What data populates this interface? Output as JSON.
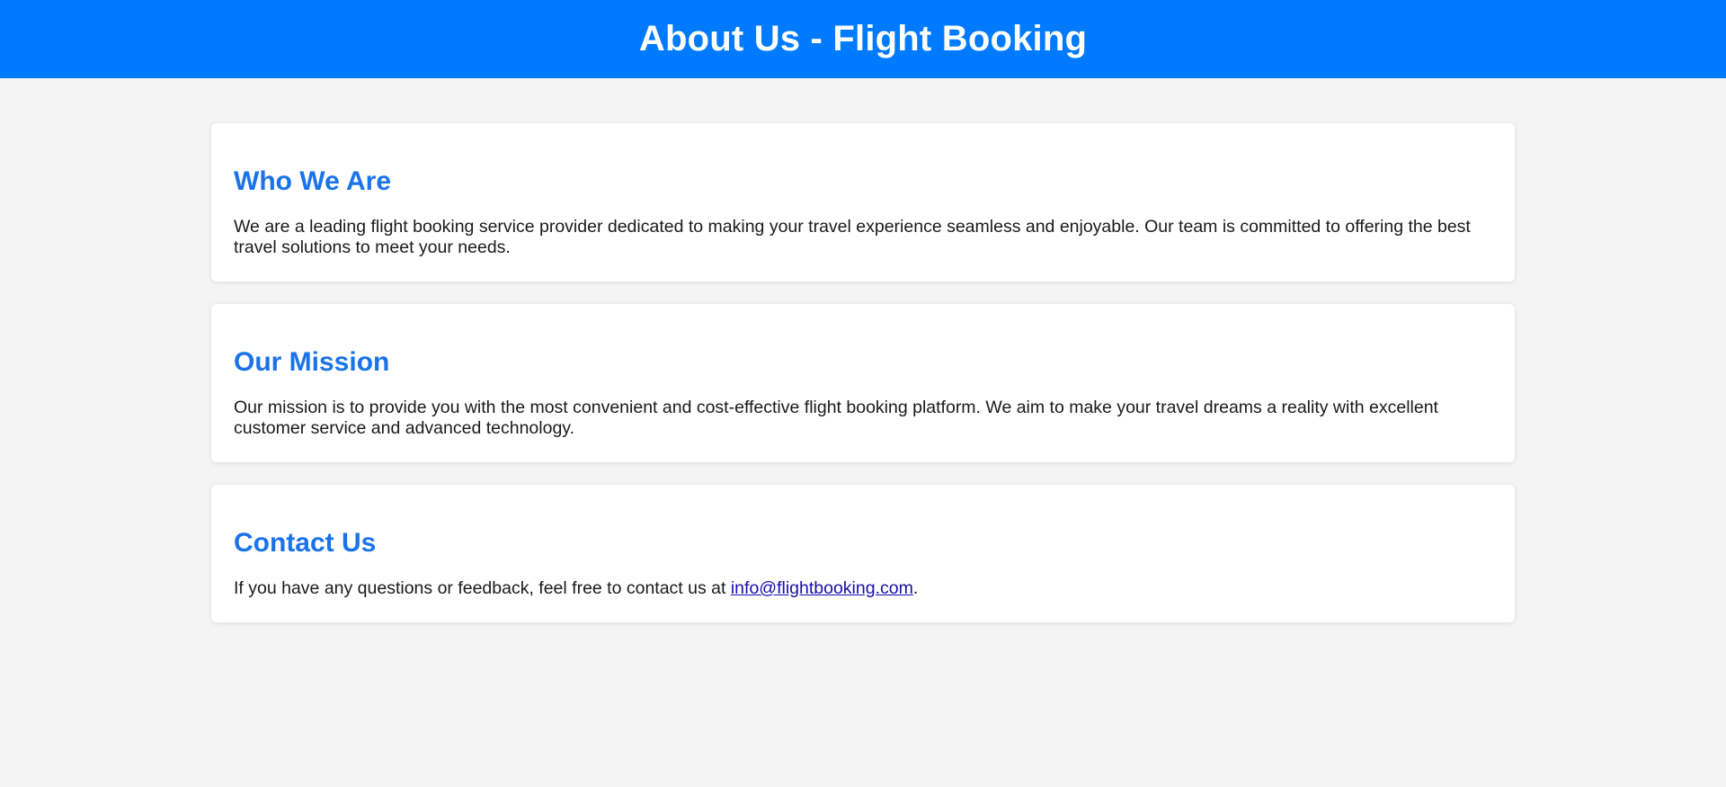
{
  "header": {
    "title": "About Us - Flight Booking"
  },
  "sections": [
    {
      "heading": "Who We Are",
      "text": "We are a leading flight booking service provider dedicated to making your travel experience seamless and enjoyable. Our team is committed to offering the best travel solutions to meet your needs."
    },
    {
      "heading": "Our Mission",
      "text": "Our mission is to provide you with the most convenient and cost-effective flight booking platform. We aim to make your travel dreams a reality with excellent customer service and advanced technology."
    },
    {
      "heading": "Contact Us",
      "text_before": "If you have any questions or feedback, feel free to contact us at ",
      "email": "info@flightbooking.com",
      "text_after": "."
    }
  ],
  "colors": {
    "header_bg": "#007bff",
    "heading": "#1a73e8",
    "link": "#1a0dab",
    "page_bg": "#f4f4f4"
  }
}
